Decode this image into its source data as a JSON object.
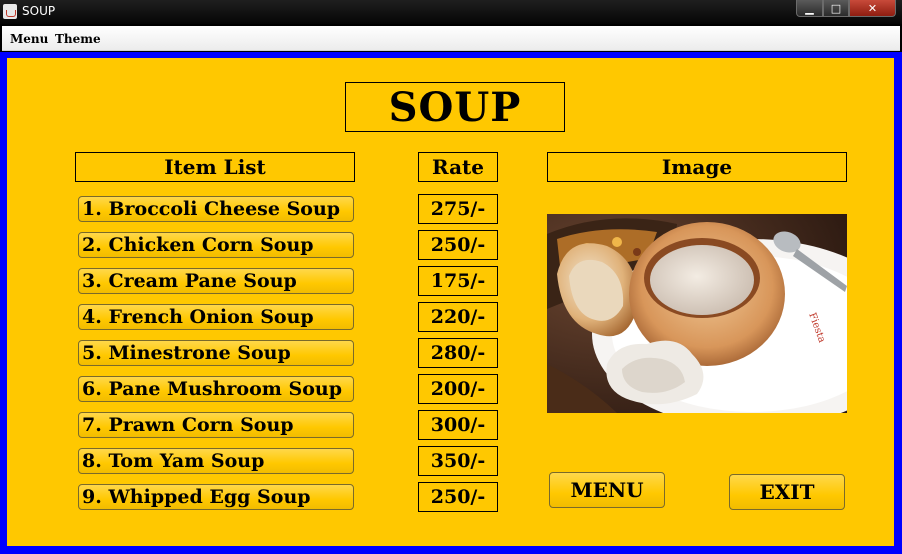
{
  "window": {
    "title": "SOUP",
    "controls": [
      "minimize",
      "maximize",
      "close"
    ]
  },
  "menubar": {
    "items": [
      "Menu",
      "Theme"
    ]
  },
  "page": {
    "title": "SOUP",
    "headers": {
      "items": "Item List",
      "rate": "Rate",
      "image": "Image"
    },
    "items": [
      {
        "name": "1. Broccoli Cheese Soup",
        "rate": "275/-"
      },
      {
        "name": "2. Chicken Corn Soup",
        "rate": "250/-"
      },
      {
        "name": "3. Cream Pane Soup",
        "rate": "175/-"
      },
      {
        "name": "4. French Onion Soup",
        "rate": "220/-"
      },
      {
        "name": "5. Minestrone Soup",
        "rate": "280/-"
      },
      {
        "name": "6. Pane Mushroom Soup",
        "rate": "200/-"
      },
      {
        "name": "7. Prawn Corn Soup",
        "rate": "300/-"
      },
      {
        "name": "8. Tom Yam Soup",
        "rate": "350/-"
      },
      {
        "name": "9. Whipped Egg Soup",
        "rate": "250/-"
      }
    ],
    "buttons": {
      "menu": "MENU",
      "exit": "EXIT"
    }
  },
  "colors": {
    "panel": "#ffc800",
    "frame_border": "#0000ff"
  }
}
